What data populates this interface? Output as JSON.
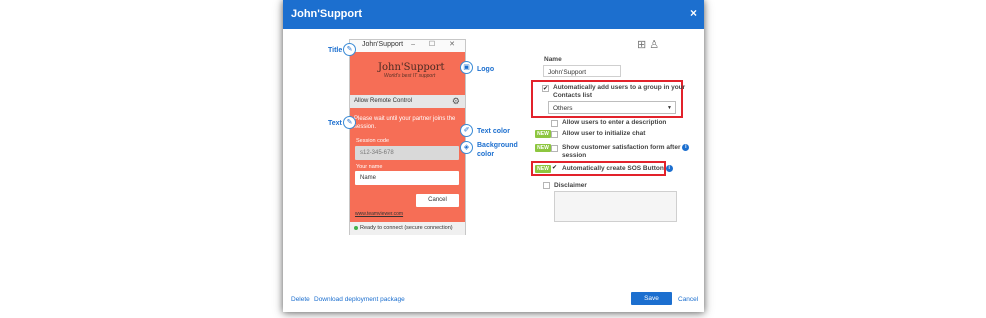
{
  "dialog": {
    "title": "John'Support",
    "close_glyph": "×"
  },
  "preview": {
    "window_title": "John'Support",
    "window_controls": "–  ☐  ✕",
    "logo_text": "John'Support",
    "logo_tagline": "World's best IT support",
    "remote_control": "Allow Remote Control",
    "body_text": "Please wait until your partner joins the session.",
    "session_code_label": "Session code",
    "session_code_placeholder": "s12-345-678",
    "your_name_label": "Your name",
    "name_value": "Name",
    "cancel_label": "Cancel",
    "link": "www.teamviewer.com",
    "status": "Ready to connect (secure connection)"
  },
  "annotations": {
    "title": "Title",
    "logo": "Logo",
    "text": "Text",
    "text_color": "Text color",
    "background_color_line1": "Background",
    "background_color_line2": "color"
  },
  "settings": {
    "name_label": "Name",
    "name_value": "John'Support",
    "add_to_group_line1": "Automatically add users to a group in your",
    "add_to_group_line2": "Contacts list",
    "group_selected": "Others",
    "allow_description": "Allow users to enter a description",
    "allow_chat": "Allow user to initialize chat",
    "satisfaction_line1": "Show customer satisfaction form after",
    "satisfaction_line2": "session",
    "sos_button": "Automatically create SOS Button",
    "disclaimer": "Disclaimer",
    "new_badge": "NEW"
  },
  "footer": {
    "delete": "Delete",
    "download": "Download deployment package",
    "save": "Save",
    "cancel": "Cancel"
  },
  "colors": {
    "titlebar": "#1c6fcf",
    "preview_background": "#f66e56",
    "highlight": "#e2222b",
    "new_badge": "#8dc63f"
  },
  "icons": [
    "windows-icon",
    "apple-icon",
    "linux-icon",
    "pencil-icon",
    "palette-icon",
    "gear-icon",
    "info-icon"
  ]
}
